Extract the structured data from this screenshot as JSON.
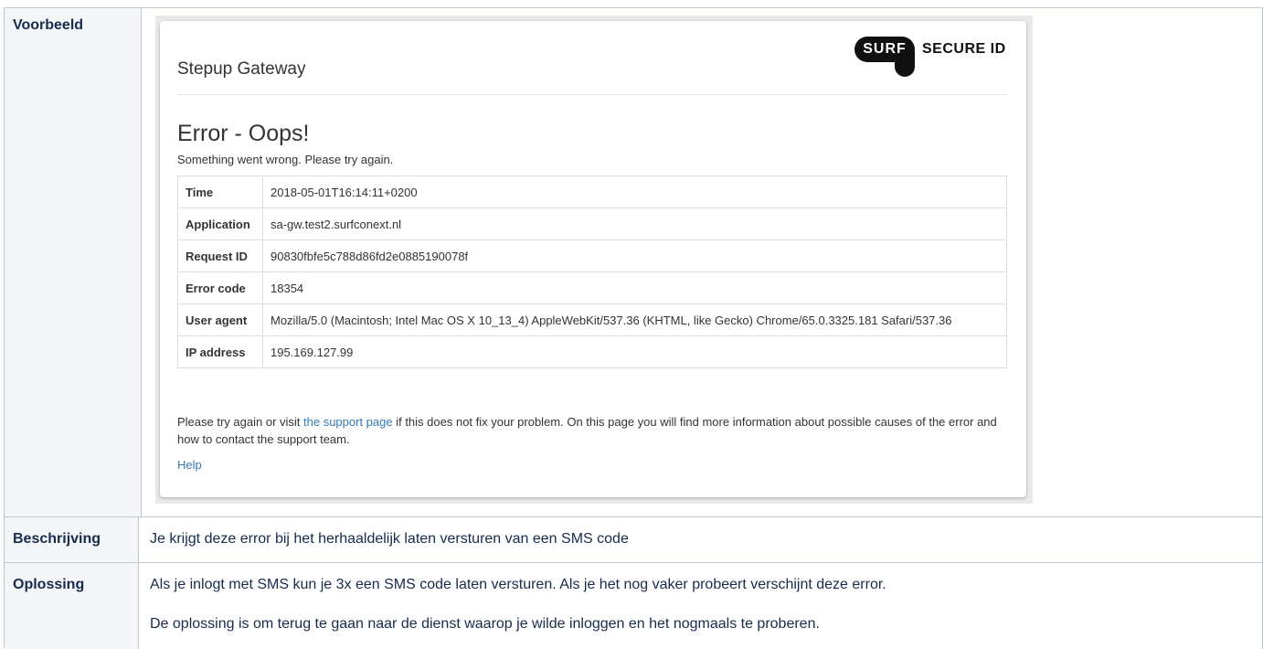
{
  "table": {
    "rows": [
      {
        "header": "Voorbeeld"
      },
      {
        "header": "Beschrijving",
        "text": "Je krijgt deze error bij het herhaaldelijk laten versturen van een SMS code"
      },
      {
        "header": "Oplossing",
        "lines": [
          "Als je inlogt met SMS kun je 3x een SMS code laten versturen. Als je het nog vaker probeert verschijnt deze error.",
          "De oplossing is om terug te gaan naar de dienst waarop je wilde inloggen en het nogmaals te proberen."
        ]
      }
    ]
  },
  "screenshot": {
    "gateway_title": "Stepup Gateway",
    "logo": {
      "pill": "SURF",
      "text": "SECURE ID"
    },
    "error_title": "Error - Oops!",
    "error_subtitle": "Something went wrong. Please try again.",
    "details": [
      {
        "label": "Time",
        "value": "2018-05-01T16:14:11+0200"
      },
      {
        "label": "Application",
        "value": "sa-gw.test2.surfconext.nl"
      },
      {
        "label": "Request ID",
        "value": "90830fbfe5c788d86fd2e0885190078f"
      },
      {
        "label": "Error code",
        "value": "18354"
      },
      {
        "label": "User agent",
        "value": "Mozilla/5.0 (Macintosh; Intel Mac OS X 10_13_4) AppleWebKit/537.36 (KHTML, like Gecko) Chrome/65.0.3325.181 Safari/537.36"
      },
      {
        "label": "IP address",
        "value": "195.169.127.99"
      }
    ],
    "note_before": "Please try again or visit ",
    "note_link": "the support page",
    "note_after": " if this does not fix your problem. On this page you will find more information about possible causes of the error and how to contact the support team.",
    "help_link": "Help"
  },
  "colors": {
    "link": "#337ab7",
    "header_bg": "#f4f5f7",
    "border": "#c1c7d0",
    "logo": "#111111"
  }
}
